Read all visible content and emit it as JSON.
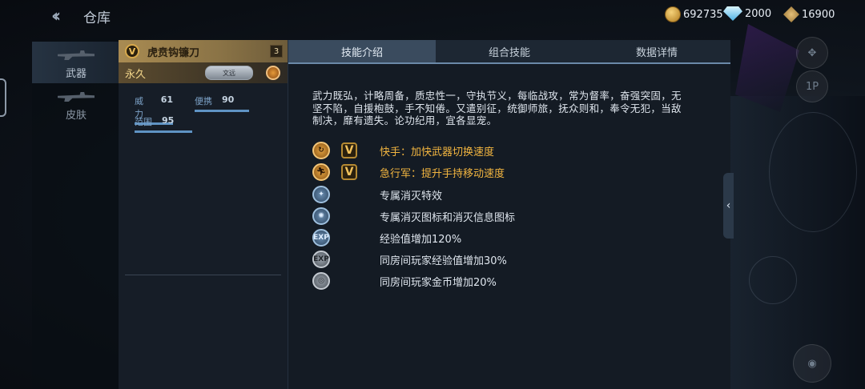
{
  "header": {
    "title": "仓库",
    "currencies": [
      {
        "icon": "gold-coin-icon",
        "value": "692735"
      },
      {
        "icon": "diamond-icon",
        "value": "2000"
      },
      {
        "icon": "ticket-icon",
        "value": "16900"
      }
    ]
  },
  "categories": [
    {
      "label": "武器",
      "active": true
    },
    {
      "label": "皮肤",
      "active": false
    }
  ],
  "weapon": {
    "name": "虎贲钩镰刀",
    "badge": "V",
    "level": "3",
    "duration": "永久",
    "tag_label": "文远",
    "stats": [
      {
        "label": "威力",
        "value": "61"
      },
      {
        "label": "便携",
        "value": "90"
      },
      {
        "label": "范围",
        "value": "95"
      }
    ]
  },
  "tabs": [
    {
      "label": "技能介绍",
      "active": true
    },
    {
      "label": "组合技能",
      "active": false
    },
    {
      "label": "数据详情",
      "active": false
    }
  ],
  "description": "武力既弘，计略周备，质忠性一，守执节义，每临战攻，常为督率，奋强突固，无坚不陷，自援枹鼓，手不知倦。又遣别征，统御师旅，抚众则和，奉令无犯，当敌制决，靡有遗失。论功纪用，宜各显宠。",
  "skills": [
    {
      "icon": "quick-hand-icon",
      "style": "gold",
      "v": true,
      "text": "快手：加快武器切换速度",
      "color": "gold"
    },
    {
      "icon": "running-man-icon",
      "style": "gold",
      "v": true,
      "text": "急行军：提升手持移动速度",
      "color": "gold"
    },
    {
      "icon": "kill-effect-icon",
      "style": "blue",
      "v": false,
      "text": "专属消灭特效",
      "color": "white"
    },
    {
      "icon": "kill-badge-icon",
      "style": "blue",
      "v": false,
      "text": "专属消灭图标和消灭信息图标",
      "color": "white"
    },
    {
      "icon": "exp-boost-icon",
      "style": "blue",
      "v": false,
      "text": "经验值增加120%",
      "color": "white",
      "glyph": "EXP"
    },
    {
      "icon": "room-exp-icon",
      "style": "gray",
      "v": false,
      "text": "同房间玩家经验值增加30%",
      "color": "white",
      "glyph": "EXP"
    },
    {
      "icon": "room-coin-icon",
      "style": "gray",
      "v": false,
      "text": "同房间玩家金币增加20%",
      "color": "white"
    }
  ],
  "background": {
    "side_button_1p": "1P"
  }
}
